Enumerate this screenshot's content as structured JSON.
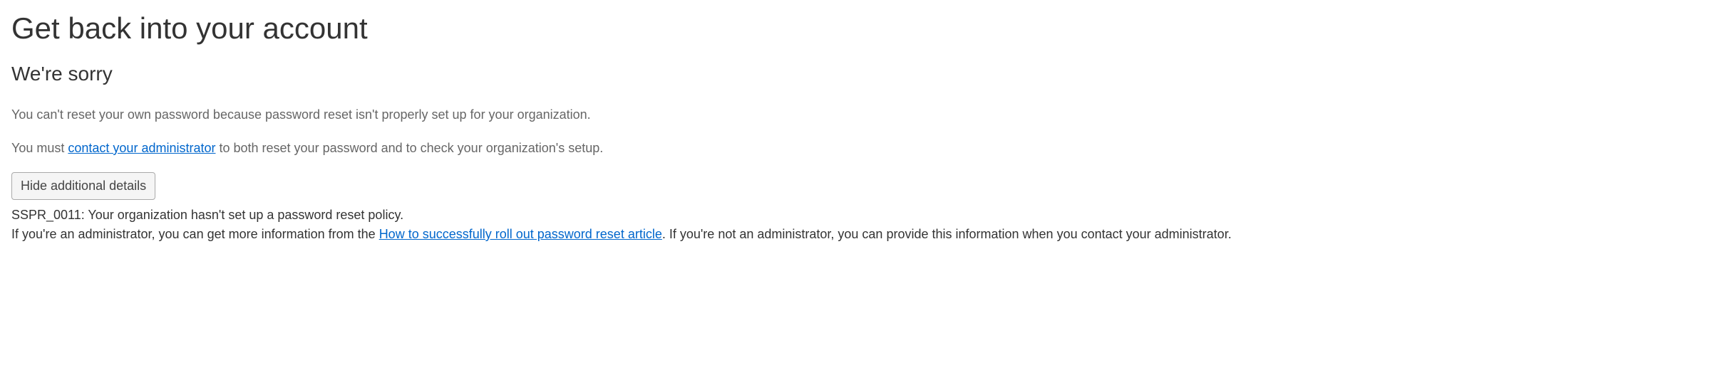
{
  "heading": "Get back into your account",
  "subheading": "We're sorry",
  "message1": "You can't reset your own password because password reset isn't properly set up for your organization.",
  "message2": {
    "prefix": "You must ",
    "link_text": "contact your administrator",
    "suffix": " to both reset your password and to check your organization's setup."
  },
  "button_label": "Hide additional details",
  "details": {
    "error_code": "SSPR_0011: Your organization hasn't set up a password reset policy.",
    "admin_info": {
      "prefix": "If you're an administrator, you can get more information from the ",
      "link_text": "How to successfully roll out password reset article",
      "suffix": ". If you're not an administrator, you can provide this information when you contact your administrator."
    }
  }
}
